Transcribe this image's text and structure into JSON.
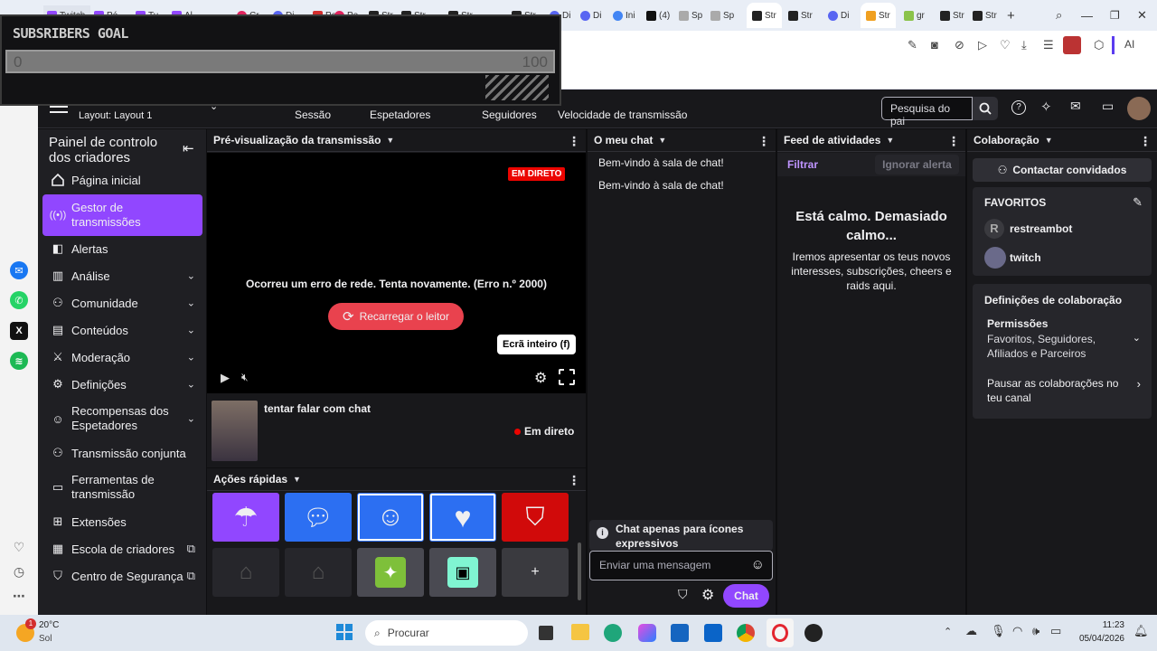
{
  "browser": {
    "tabs": [
      "Twitch",
      "Pé",
      "Tu",
      "Al",
      "Cr",
      "Di",
      "Pa",
      "Pe",
      "Str",
      "Str",
      "Str",
      "Str",
      "Di",
      "Di",
      "Ini",
      "(4)",
      "Sp",
      "Sp",
      "Str",
      "Str",
      "Di",
      "Str",
      "gr",
      "Str",
      "Str"
    ],
    "new_tab": "+",
    "ai_label": "AI"
  },
  "overlay": {
    "title": "SUBSRIBERS GOAL",
    "current": "0",
    "target": "100"
  },
  "topnav": {
    "layout": "Layout: Layout 1",
    "stats": [
      "Sessão",
      "Espetadores",
      "Seguidores",
      "Velocidade de transmissão"
    ],
    "search_placeholder": "Pesquisa do pai"
  },
  "leftnav": {
    "title": "Painel de controlo dos criadores",
    "items": [
      {
        "label": "Página inicial",
        "icon": "home-icon"
      },
      {
        "label": "Gestor de transmissões",
        "icon": "broadcast-icon"
      },
      {
        "label": "Alertas",
        "icon": "alert-icon"
      },
      {
        "label": "Análise",
        "icon": "analytics-icon"
      },
      {
        "label": "Comunidade",
        "icon": "community-icon"
      },
      {
        "label": "Conteúdos",
        "icon": "content-icon"
      },
      {
        "label": "Moderação",
        "icon": "sword-icon"
      },
      {
        "label": "Definições",
        "icon": "gear-icon"
      },
      {
        "label": "Recompensas dos Espetadores",
        "icon": "reward-icon"
      },
      {
        "label": "Transmissão conjunta",
        "icon": "collab-icon"
      },
      {
        "label": "Ferramentas de transmissão",
        "icon": "camera-icon"
      },
      {
        "label": "Extensões",
        "icon": "extension-icon"
      },
      {
        "label": "Escola de criadores",
        "icon": "school-icon"
      },
      {
        "label": "Centro de Segurança",
        "icon": "shield-icon"
      }
    ]
  },
  "preview": {
    "header": "Pré-visualização da transmissão",
    "live_badge": "EM DIRETO",
    "error": "Ocorreu um erro de rede. Tenta novamente. (Erro n.º 2000)",
    "reload": "Recarregar o leitor",
    "tooltip": "Ecrã inteiro (f)",
    "stream_title": "tentar falar com chat",
    "status": "Em direto"
  },
  "quick_actions": {
    "header": "Ações rápidas",
    "add": "+"
  },
  "chat": {
    "header": "O meu chat",
    "messages": [
      "Bem-vindo à sala de chat!",
      "Bem-vindo à sala de chat!"
    ],
    "emote_only": "Chat apenas para ícones expressivos",
    "placeholder": "Enviar uma mensagem",
    "send": "Chat"
  },
  "activity": {
    "header": "Feed de atividades",
    "filter": "Filtrar",
    "ignore": "Ignorar alerta",
    "calm_title": "Está calmo. Demasiado calmo...",
    "calm_text": "Iremos apresentar os teus novos interesses, subscrições, cheers e raids aqui."
  },
  "collab": {
    "header": "Colaboração",
    "contact": "Contactar convidados",
    "favorites": "FAVORITOS",
    "users": [
      "restreambot",
      "twitch"
    ],
    "settings_title": "Definições de colaboração",
    "permissions_title": "Permissões",
    "permissions_value": "Favoritos, Seguidores, Afiliados e Parceiros",
    "pause": "Pausar as colaborações no teu canal"
  },
  "taskbar": {
    "temp": "20°C",
    "weather": "Sol",
    "badge": "1",
    "search": "Procurar",
    "time": "11:23",
    "date": "05/04/2026"
  },
  "colors": {
    "accent": "#9147ff",
    "live": "#eb0400",
    "bg": "#0e0e10"
  }
}
